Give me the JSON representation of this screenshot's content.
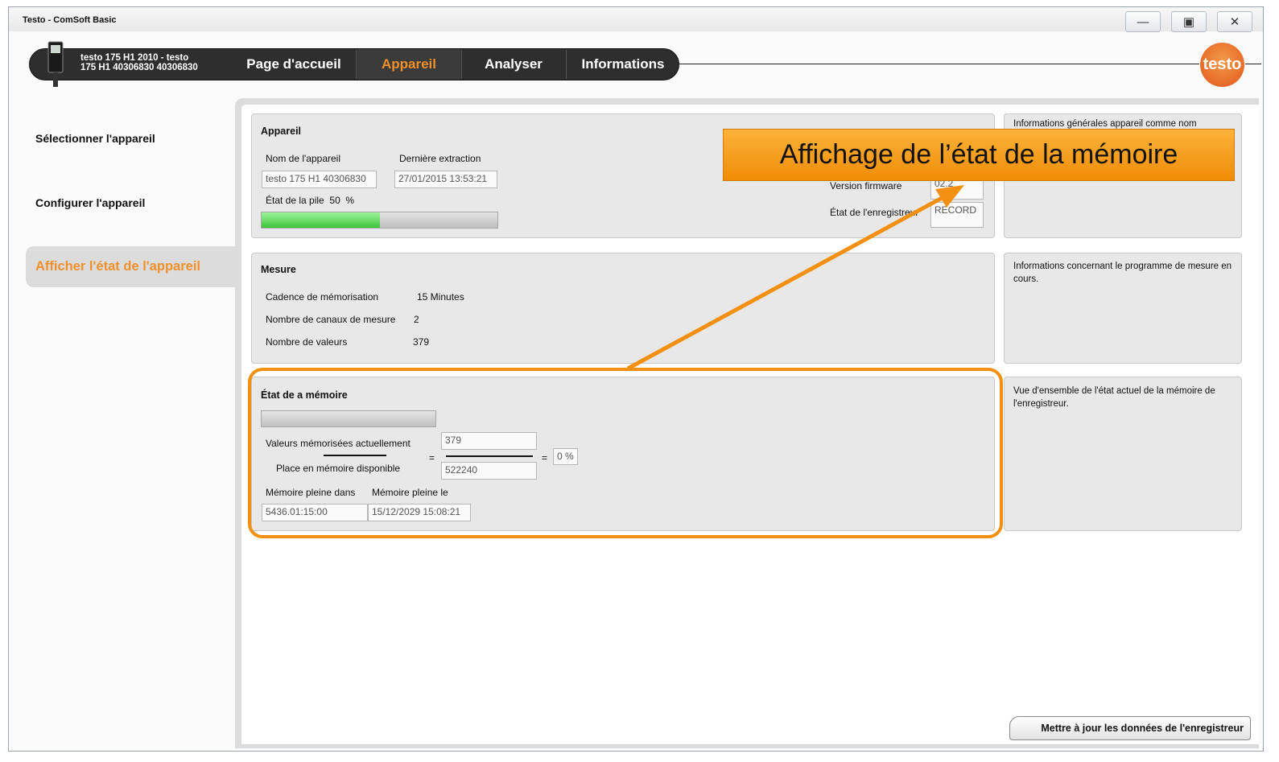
{
  "window": {
    "title": "Testo - ComSoft Basic"
  },
  "nav": {
    "device_line1": "testo 175 H1 2010 - testo",
    "device_line2": "175 H1 40306830 40306830",
    "tabs": [
      "Page d'accueil",
      "Appareil",
      "Analyser",
      "Informations"
    ],
    "active_tab": "Appareil",
    "logo": "testo"
  },
  "sidebar": {
    "items": [
      "Sélectionner l'appareil",
      "Configurer l'appareil",
      "Afficher l'état de l'appareil"
    ],
    "active": "Afficher l'état de l'appareil"
  },
  "appareil": {
    "title": "Appareil",
    "name_label": "Nom de l'appareil",
    "name_value": "testo 175 H1 40306830",
    "extraction_label": "Dernière extraction",
    "extraction_value": "27/01/2015 13:53:21",
    "battery_label": "État de la pile",
    "battery_value": "50",
    "battery_unit": "%",
    "battery_fraction": 0.5,
    "firmware_label": "Version firmware",
    "firmware_value": "02.2",
    "recorder_label": "État de l'enregistreur",
    "recorder_value": "RECORD"
  },
  "mesure": {
    "title": "Mesure",
    "rows": [
      {
        "label": "Cadence de mémorisation",
        "value": "15 Minutes"
      },
      {
        "label": "Nombre de canaux de mesure",
        "value": "2"
      },
      {
        "label": "Nombre de valeurs",
        "value": "379"
      }
    ]
  },
  "memoire": {
    "title": "État de a mémoire",
    "current_label": "Valeurs mémorisées actuellement",
    "current_value": "379",
    "available_label": "Place en mémoire disponible",
    "available_value": "522240",
    "equals": "=",
    "percent": "0 %",
    "fill_fraction": 0.0,
    "full_in_label": "Mémoire pleine dans",
    "full_in_value": "5436.01:15:00",
    "full_on_label": "Mémoire pleine le",
    "full_on_value": "15/12/2029 15:08:21"
  },
  "info_panels": [
    "Informations générales appareil comme nom",
    "Informations concernant le programme de mesure en cours.",
    "Vue d'ensemble de l'état actuel de la mémoire de l'enregistreur."
  ],
  "callout": "Affichage de l’état de la mémoire",
  "update_button": "Mettre à jour les données de l'enregistreur",
  "colors": {
    "accent": "#f08c06",
    "tab_active": "#f0902a",
    "highlight": "#f39012"
  }
}
